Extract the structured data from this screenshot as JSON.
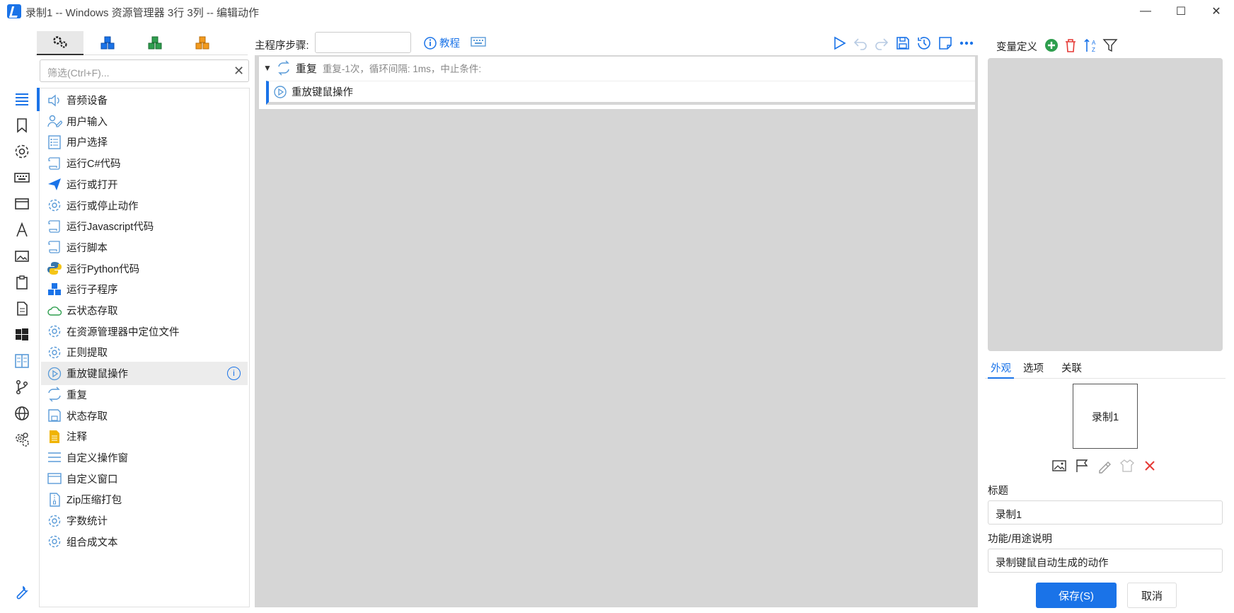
{
  "window": {
    "title": "录制1 -- Windows 资源管理器 3行 3列 -- 编辑动作",
    "minimize_glyph": "—",
    "maximize_glyph": "☐",
    "close_glyph": "✕"
  },
  "rail": {
    "icons": [
      "list-icon",
      "bookmark-icon",
      "gear-icon",
      "keyboard-icon",
      "window-icon",
      "font-icon",
      "image-icon",
      "clipboard-icon",
      "document-icon",
      "windows-logo-icon",
      "compare-icon",
      "branch-icon",
      "globe-icon",
      "gears-icon"
    ],
    "bottom_icon": "wrench-icon"
  },
  "category_tabs": [
    "gears-icon",
    "blue-cubes-icon",
    "green-cubes-icon",
    "orange-cubes-icon"
  ],
  "filter": {
    "placeholder": "筛选(Ctrl+F)...",
    "clear_glyph": "✕"
  },
  "actions": [
    {
      "label": "音频设备",
      "icon": "speaker-icon",
      "color": "#5a9bd8"
    },
    {
      "label": "用户输入",
      "icon": "user-input-icon",
      "color": "#5a9bd8"
    },
    {
      "label": "用户选择",
      "icon": "checklist-icon",
      "color": "#5a9bd8"
    },
    {
      "label": "运行C#代码",
      "icon": "script-icon",
      "color": "#5a9bd8"
    },
    {
      "label": "运行或打开",
      "icon": "paper-plane-icon",
      "color": "#1a73e8"
    },
    {
      "label": "运行或停止动作",
      "icon": "gear-icon",
      "color": "#5a9bd8"
    },
    {
      "label": "运行Javascript代码",
      "icon": "script-icon",
      "color": "#5a9bd8"
    },
    {
      "label": "运行脚本",
      "icon": "script-icon",
      "color": "#5a9bd8"
    },
    {
      "label": "运行Python代码",
      "icon": "python-icon",
      "color": "#3776ab"
    },
    {
      "label": "运行子程序",
      "icon": "cubes-icon",
      "color": "#1a73e8"
    },
    {
      "label": "云状态存取",
      "icon": "cloud-icon",
      "color": "#2e9e4e"
    },
    {
      "label": "在资源管理器中定位文件",
      "icon": "gear-icon",
      "color": "#5a9bd8"
    },
    {
      "label": "正则提取",
      "icon": "gear-icon",
      "color": "#5a9bd8"
    },
    {
      "label": "重放键鼠操作",
      "icon": "play-circle-icon",
      "color": "#5a9bd8",
      "selected": true
    },
    {
      "label": "重复",
      "icon": "repeat-icon",
      "color": "#5a9bd8"
    },
    {
      "label": "状态存取",
      "icon": "save-icon",
      "color": "#5a9bd8"
    },
    {
      "label": "注释",
      "icon": "note-icon",
      "color": "#f0b400"
    },
    {
      "label": "自定义操作窗",
      "icon": "lines-icon",
      "color": "#5a9bd8"
    },
    {
      "label": "自定义窗口",
      "icon": "window-icon",
      "color": "#5a9bd8"
    },
    {
      "label": "Zip压缩打包",
      "icon": "zip-icon",
      "color": "#5a9bd8"
    },
    {
      "label": "字数统计",
      "icon": "gear-icon",
      "color": "#5a9bd8"
    },
    {
      "label": "组合成文本",
      "icon": "gear-icon",
      "color": "#5a9bd8"
    }
  ],
  "editor": {
    "step_label": "主程序步骤:",
    "step_value": "",
    "tutorial_label": "教程",
    "toolbar": [
      "play-icon",
      "undo-icon",
      "redo-icon",
      "save-icon",
      "history-icon",
      "note-icon",
      "more-icon"
    ],
    "repeat": {
      "title": "重复",
      "description": "重复-1次，循环间隔: 1ms，中止条件:"
    },
    "child_step": "重放键鼠操作"
  },
  "variables": {
    "title": "变量定义"
  },
  "properties": {
    "tabs": [
      "外观",
      "选项",
      "关联"
    ],
    "active_tab": 0,
    "preview_text": "录制1",
    "title_label": "标题",
    "title_value": "录制1",
    "desc_label": "功能/用途说明",
    "desc_value": "录制键鼠自动生成的动作",
    "save_label": "保存(S)",
    "cancel_label": "取消"
  },
  "colors": {
    "accent": "#1a73e8",
    "canvas": "#d6d6d6",
    "add_green": "#2e9e4e",
    "delete_red": "#e53935"
  }
}
